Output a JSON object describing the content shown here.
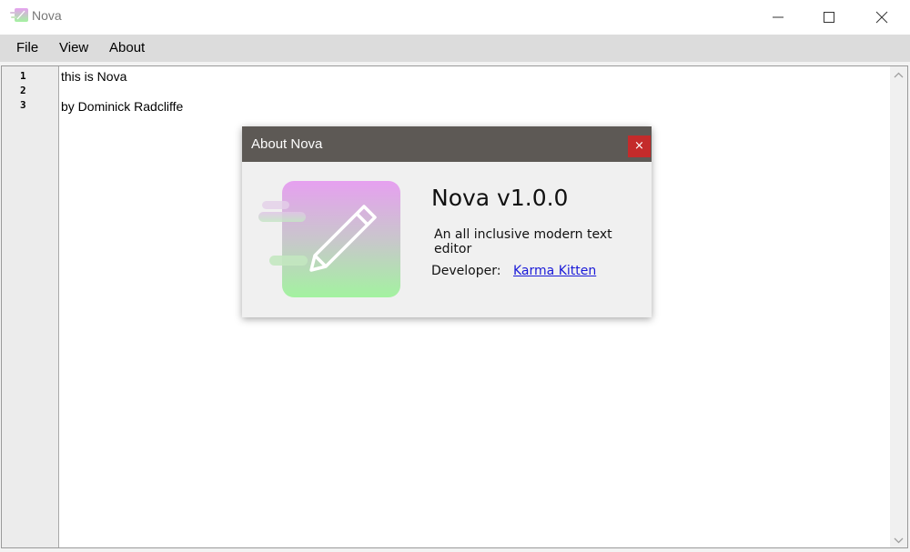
{
  "window": {
    "title": "Nova",
    "icon": "nova-app-icon",
    "controls": [
      "minimize-icon",
      "maximize-icon",
      "close-icon"
    ]
  },
  "menu": {
    "items": [
      {
        "label": "File"
      },
      {
        "label": "View"
      },
      {
        "label": "About"
      }
    ]
  },
  "editor": {
    "line_numbers": [
      "1",
      "2",
      "3"
    ],
    "lines": [
      "this is Nova",
      "",
      "by Dominick Radcliffe"
    ]
  },
  "dialog": {
    "title": "About Nova",
    "close_label": "×",
    "app_name": "Nova v1.0.0",
    "tagline": "An all inclusive modern text editor",
    "developer_label": "Developer:",
    "developer_name": "Karma Kitten",
    "logo": "pencil-logo"
  },
  "colors": {
    "dialog_titlebar": "#5d5955",
    "dialog_close": "#c42b2b",
    "logo_gradient_top": "#e6a0f0",
    "logo_gradient_bottom": "#a3f2a0",
    "link": "#1a1ad8"
  }
}
